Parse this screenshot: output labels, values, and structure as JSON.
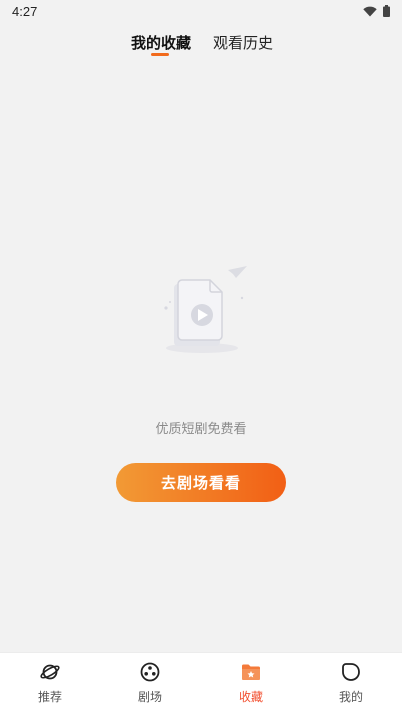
{
  "status_bar": {
    "time": "4:27",
    "wifi_icon": "wifi-icon",
    "battery_icon": "battery-icon"
  },
  "tabs": [
    {
      "label": "我的收藏",
      "active": true
    },
    {
      "label": "观看历史",
      "active": false
    }
  ],
  "empty_state": {
    "illustration_icon": "video-file-icon",
    "message": "优质短剧免费看",
    "button_label": "去剧场看看"
  },
  "bottom_nav": [
    {
      "label": "推荐",
      "icon": "planet-icon",
      "active": false
    },
    {
      "label": "剧场",
      "icon": "film-reel-icon",
      "active": false
    },
    {
      "label": "收藏",
      "icon": "folder-star-icon",
      "active": true
    },
    {
      "label": "我的",
      "icon": "profile-leaf-icon",
      "active": false
    }
  ],
  "colors": {
    "accent": "#f26b1d",
    "active_nav": "#f24e2e",
    "button_gradient_start": "#f29a35",
    "button_gradient_end": "#f25f15",
    "background": "#f2f2f2"
  }
}
